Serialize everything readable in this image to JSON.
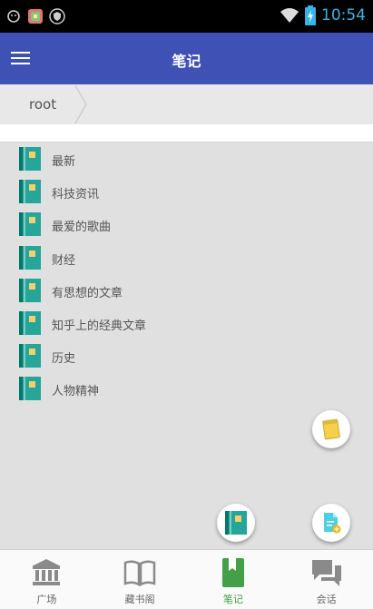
{
  "status_bar": {
    "time": "10:54",
    "icons": [
      "notification-icon",
      "app-icon",
      "shield-icon",
      "wifi-icon",
      "battery-icon"
    ]
  },
  "app_bar": {
    "title": "笔记",
    "menu_icon": "hamburger-menu-icon"
  },
  "breadcrumb": {
    "items": [
      "root"
    ]
  },
  "notebooks": [
    {
      "label": "最新"
    },
    {
      "label": "科技资讯"
    },
    {
      "label": "最爱的歌曲"
    },
    {
      "label": "财经"
    },
    {
      "label": "有思想的文章"
    },
    {
      "label": "知乎上的经典文章"
    },
    {
      "label": "历史"
    },
    {
      "label": "人物精神"
    }
  ],
  "fabs": {
    "new_note_icon": "yellow-note-icon",
    "new_notebook_icon": "notebook-icon",
    "add_file_icon": "add-file-icon"
  },
  "bottom_nav": {
    "items": [
      {
        "label": "广场",
        "icon": "bank-icon",
        "active": false
      },
      {
        "label": "藏书阁",
        "icon": "open-book-icon",
        "active": false
      },
      {
        "label": "笔记",
        "icon": "bookmark-note-icon",
        "active": true
      },
      {
        "label": "会话",
        "icon": "chat-bubbles-icon",
        "active": false
      }
    ]
  },
  "colors": {
    "app_bar": "#3f51b5",
    "active_nav": "#43a047",
    "status_time": "#33b5e5",
    "book_teal": "#26a69a",
    "book_yellow": "#f2d06b"
  }
}
